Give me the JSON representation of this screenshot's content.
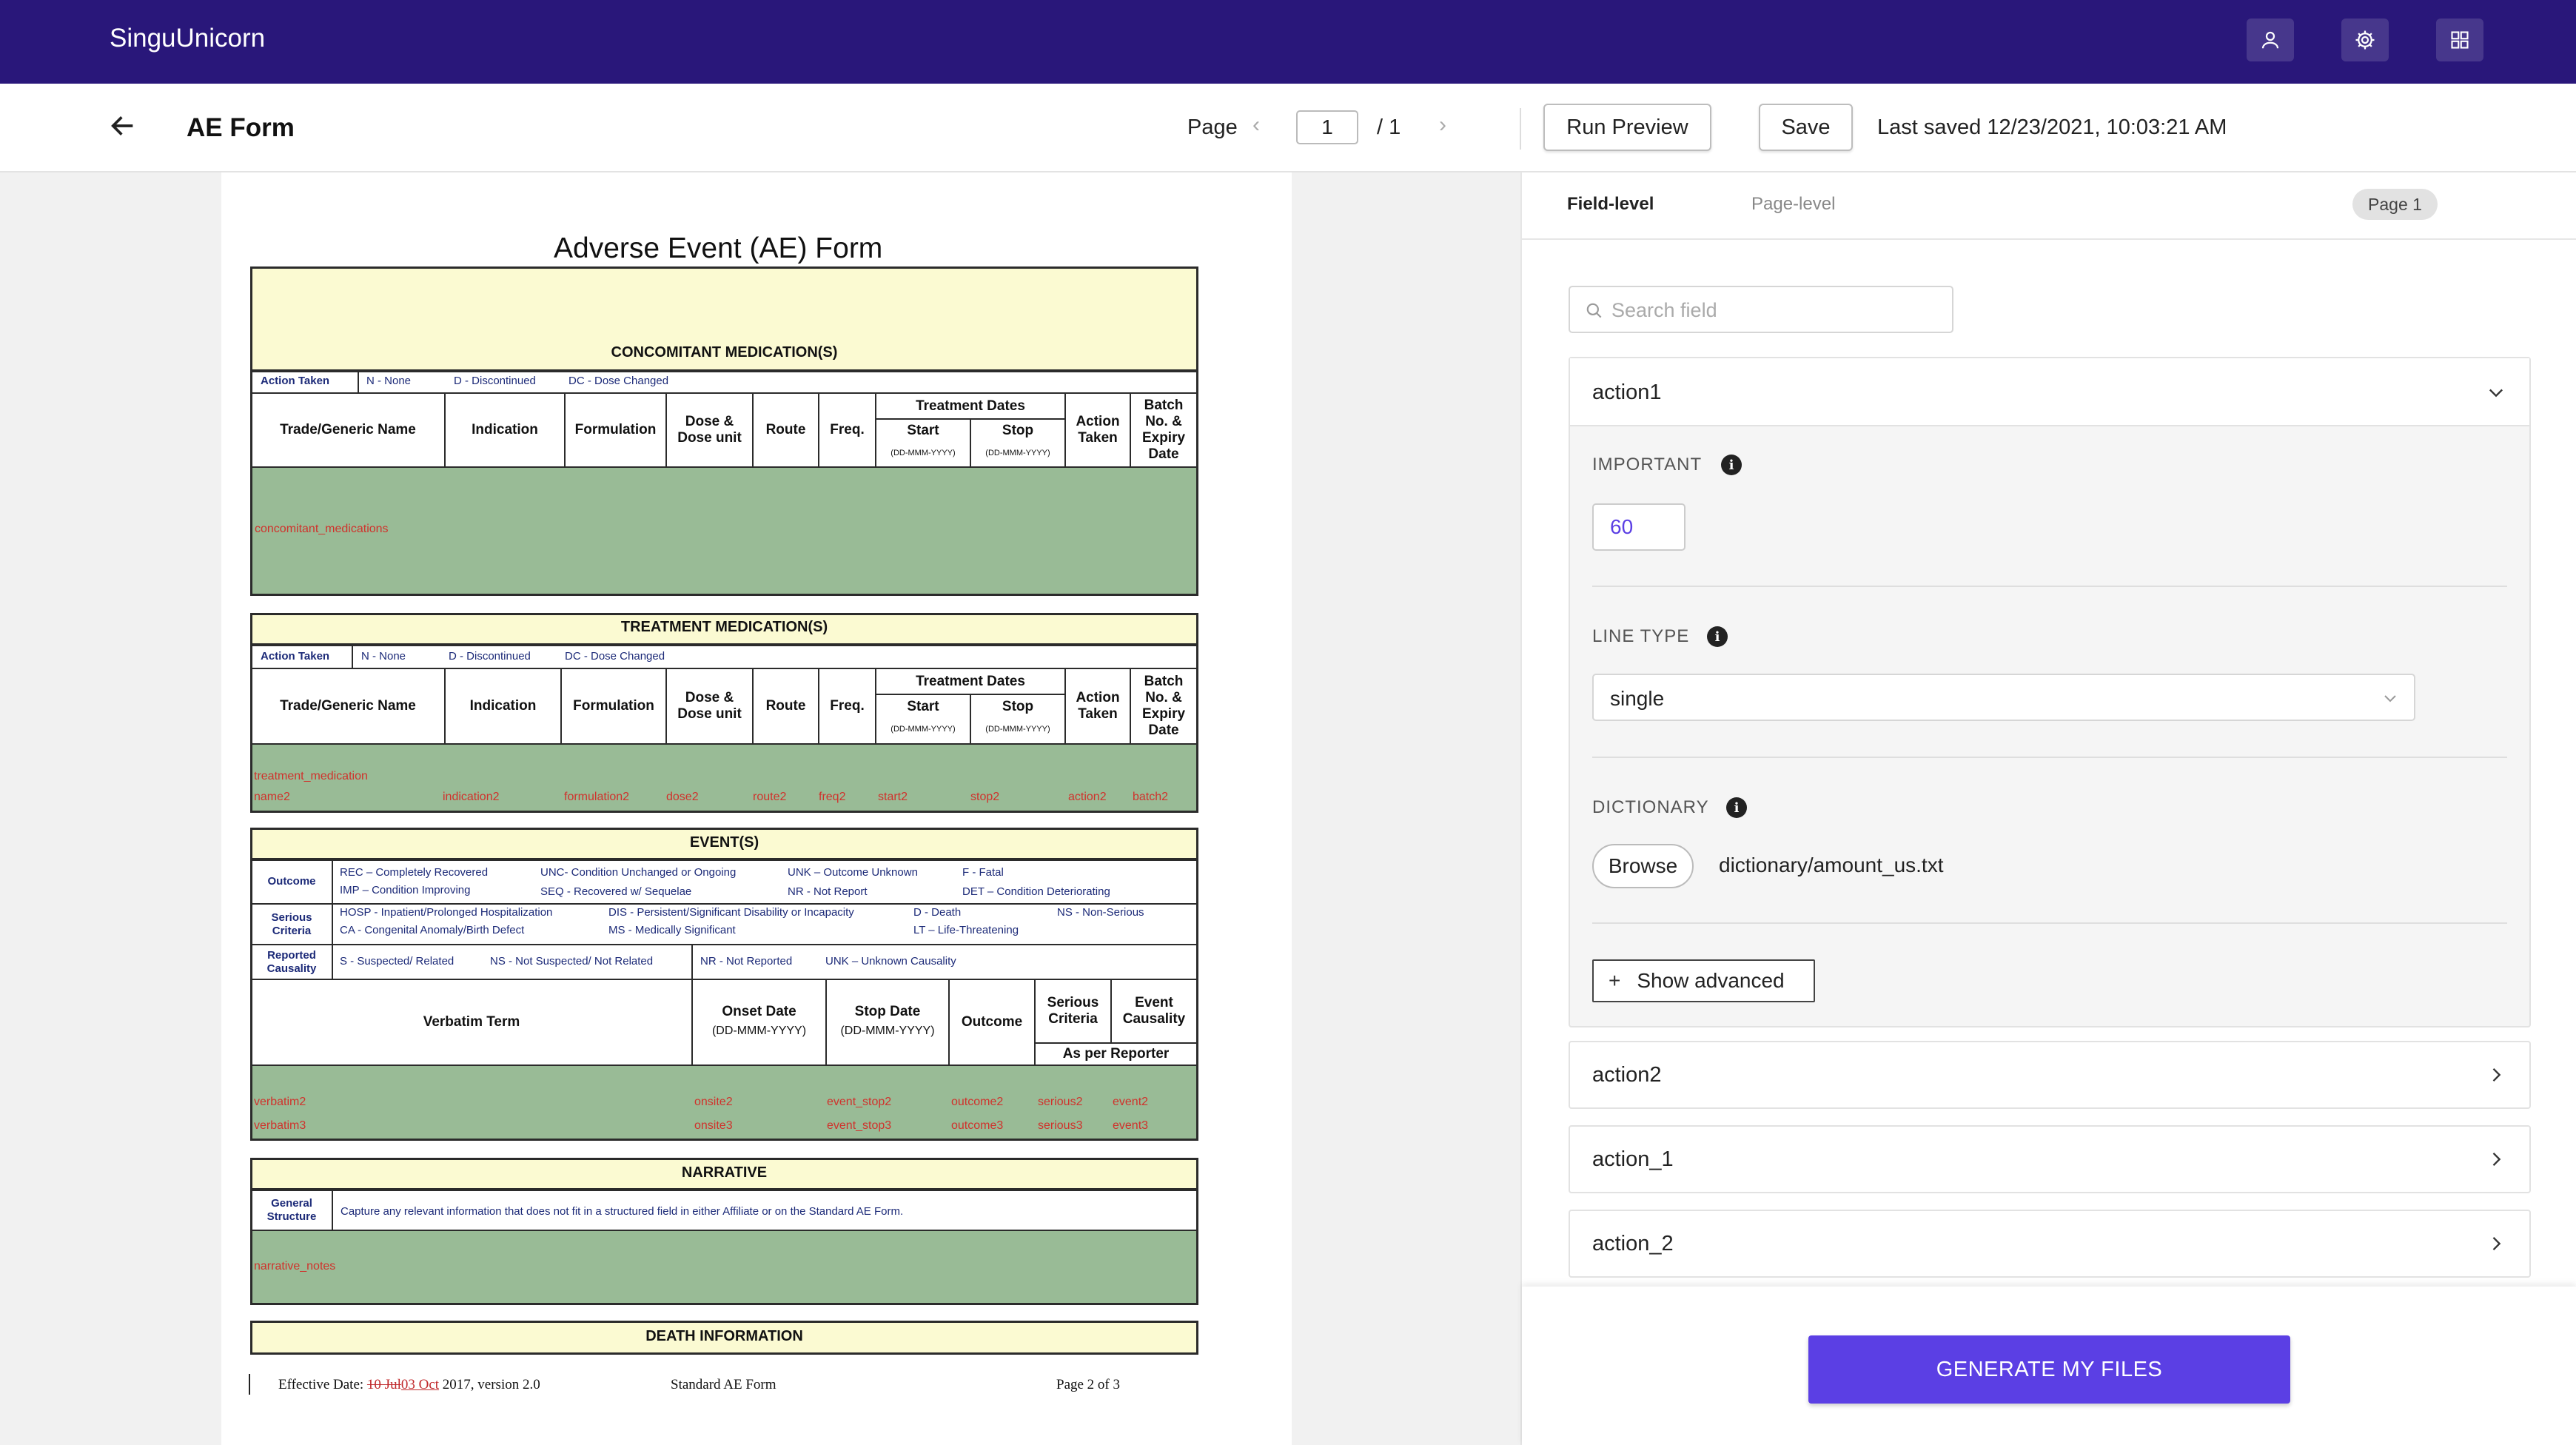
{
  "app": {
    "brand": "SinguUnicorn"
  },
  "topbar": {
    "icons": [
      "user-icon",
      "gear-icon",
      "grid-icon"
    ]
  },
  "header": {
    "title": "AE Form",
    "page_label": "Page",
    "page_value": "1",
    "page_total": "/ 1",
    "run_preview": "Run Preview",
    "save": "Save",
    "last_saved": "Last saved 12/23/2021, 10:03:21 AM"
  },
  "document": {
    "title": "Adverse Event (AE) Form",
    "concomitant": {
      "heading": "CONCOMITANT MEDICATION(S)",
      "legend": {
        "label": "Action Taken",
        "n": "N - None",
        "d": "D - Discontinued",
        "dc": "DC - Dose Changed"
      },
      "field": "concomitant_medications"
    },
    "columns": {
      "trade": "Trade/Generic Name",
      "indication": "Indication",
      "formulation": "Formulation",
      "dose": "Dose & Dose unit",
      "route": "Route",
      "freq": "Freq.",
      "treatment_dates": "Treatment Dates",
      "start": "Start",
      "start_fmt": "(DD-MMM-YYYY)",
      "stop": "Stop",
      "stop_fmt": "(DD-MMM-YYYY)",
      "action": "Action Taken",
      "batch": "Batch No. & Expiry Date"
    },
    "treatment": {
      "heading": "TREATMENT MEDICATION(S)",
      "legend": {
        "label": "Action Taken",
        "n": "N - None",
        "d": "D - Discontinued",
        "dc": "DC - Dose Changed"
      },
      "fields": {
        "name_1": "treatment_medication",
        "name_2": "name2",
        "indication": "indication2",
        "formulation": "formulation2",
        "dose": "dose2",
        "route": "route2",
        "freq": "freq2",
        "start": "start2",
        "stop": "stop2",
        "action": "action2",
        "batch": "batch2"
      }
    },
    "events": {
      "heading": "EVENT(S)",
      "outcome_label": "Outcome",
      "outcome_rows": [
        [
          "REC – Completely Recovered",
          "UNC- Condition Unchanged or Ongoing",
          "UNK – Outcome Unknown",
          "F - Fatal"
        ],
        [
          "IMP – Condition Improving",
          "SEQ - Recovered w/ Sequelae",
          "NR - Not Report",
          "DET – Condition Deteriorating"
        ]
      ],
      "serious_label": "Serious Criteria",
      "serious_rows": [
        [
          "HOSP - Inpatient/Prolonged Hospitalization",
          "DIS - Persistent/Significant Disability or Incapacity",
          "D - Death",
          "NS - Non-Serious"
        ],
        [
          "CA - Congenital Anomaly/Birth Defect",
          "MS - Medically Significant",
          "LT – Life-Threatening"
        ]
      ],
      "causality_label": "Reported Causality",
      "causality_items": [
        "S - Suspected/ Related",
        "NS - Not Suspected/ Not Related",
        "NR - Not Reported",
        "UNK – Unknown Causality"
      ],
      "cols": {
        "verbatim": "Verbatim Term",
        "onset": "Onset Date",
        "onset_fmt": "(DD-MMM-YYYY)",
        "stop": "Stop Date",
        "stop_fmt": "(DD-MMM-YYYY)",
        "outcome": "Outcome",
        "serious": "Serious Criteria",
        "causality": "Event Causality",
        "as_per": "As per Reporter"
      },
      "rows": [
        [
          "verbatim2",
          "onsite2",
          "event_stop2",
          "outcome2",
          "serious2",
          "event2"
        ],
        [
          "verbatim3",
          "onsite3",
          "event_stop3",
          "outcome3",
          "serious3",
          "event3"
        ]
      ]
    },
    "narrative": {
      "heading": "NARRATIVE",
      "general_label": "General Structure",
      "instruction": "Capture any relevant information that does not fit in a structured field in either Affiliate or on the Standard AE Form.",
      "field": "narrative_notes"
    },
    "death": {
      "heading": "DEATH INFORMATION"
    },
    "footer": {
      "effective": "Effective Date: ",
      "struck": "10 Jul",
      "inserted": "03 Oct",
      "rest": " 2017, version 2.0",
      "form": "Standard AE Form",
      "page": "Page 2 of 3"
    }
  },
  "panel": {
    "tabs": {
      "field": "Field-level",
      "page": "Page-level",
      "badge": "Page 1"
    },
    "search_placeholder": "Search field",
    "action1": {
      "title": "action1",
      "important_label": "IMPORTANT",
      "important_value": "60",
      "line_type_label": "LINE TYPE",
      "line_type_value": "single",
      "dictionary_label": "DICTIONARY",
      "browse": "Browse",
      "dictionary_value": "dictionary/amount_us.txt",
      "show_advanced": "Show advanced"
    },
    "items": [
      "action2",
      "action_1",
      "action_2"
    ],
    "generate": "GENERATE MY FILES"
  },
  "colors": {
    "topbar": "#29177a",
    "accent": "#5b3fe4",
    "form_yellow": "#fbfad2",
    "form_green": "#99bb96"
  }
}
